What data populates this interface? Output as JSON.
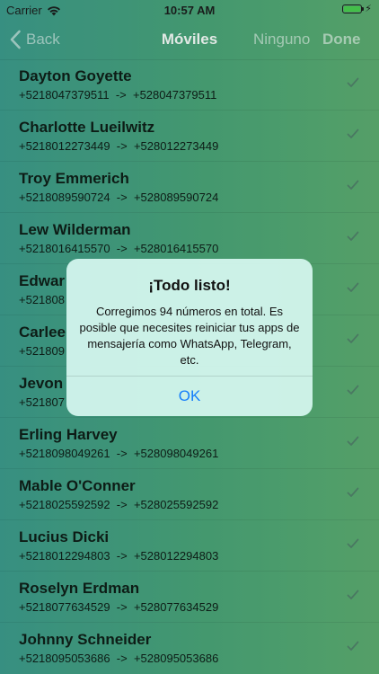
{
  "status": {
    "carrier": "Carrier",
    "time": "10:57 AM"
  },
  "nav": {
    "back_label": "Back",
    "title": "Móviles",
    "none_label": "Ninguno",
    "done_label": "Done"
  },
  "contacts": [
    {
      "name": "Dayton Goyette",
      "numbers": "+5218047379511  ->  +528047379511"
    },
    {
      "name": "Charlotte Lueilwitz",
      "numbers": "+5218012273449  ->  +528012273449"
    },
    {
      "name": "Troy Emmerich",
      "numbers": "+5218089590724  ->  +528089590724"
    },
    {
      "name": "Lew Wilderman",
      "numbers": "+5218016415570  ->  +528016415570"
    },
    {
      "name": "Edwar",
      "numbers": "+521808"
    },
    {
      "name": "Carlee",
      "numbers": "+521809"
    },
    {
      "name": "Jevon",
      "numbers": "+521807"
    },
    {
      "name": "Erling Harvey",
      "numbers": "+5218098049261  ->  +528098049261"
    },
    {
      "name": "Mable O'Conner",
      "numbers": "+5218025592592  ->  +528025592592"
    },
    {
      "name": "Lucius Dicki",
      "numbers": "+5218012294803  ->  +528012294803"
    },
    {
      "name": "Roselyn Erdman",
      "numbers": "+5218077634529  ->  +528077634529"
    },
    {
      "name": "Johnny Schneider",
      "numbers": "+5218095053686  ->  +528095053686"
    }
  ],
  "alert": {
    "title": "¡Todo listo!",
    "message": "Corregimos 94 números en total. Es posible que necesites reiniciar tus apps de mensajería como WhatsApp, Telegram, etc.",
    "ok_label": "OK"
  },
  "colors": {
    "accent": "#157efb",
    "battery": "#47c94b"
  }
}
